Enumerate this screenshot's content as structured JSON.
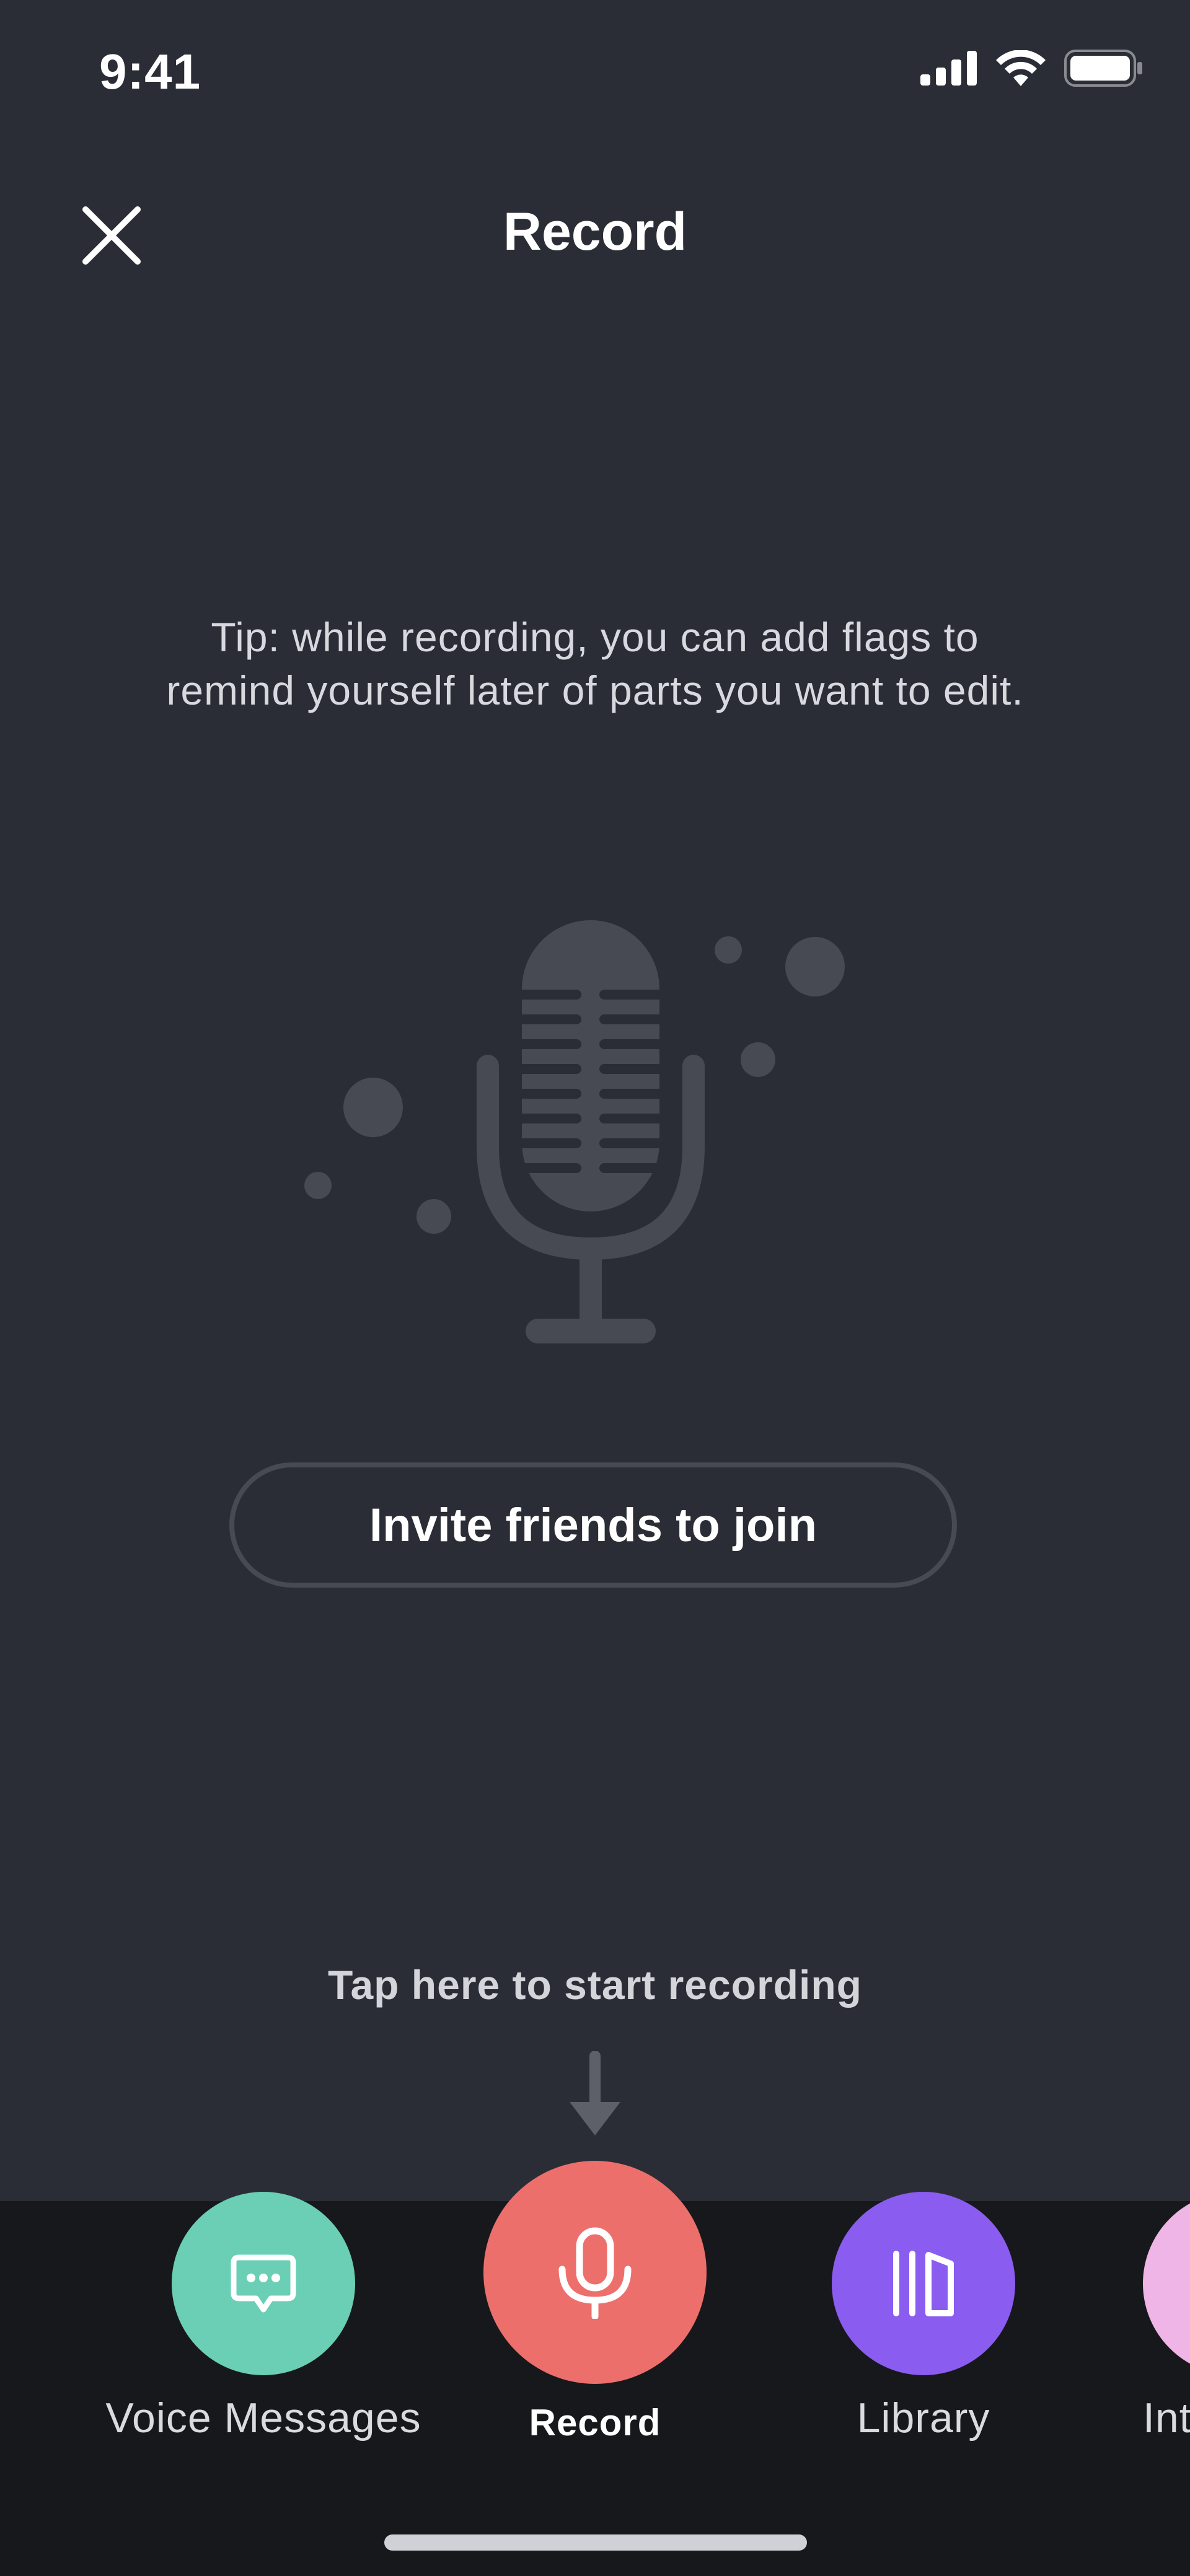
{
  "status_bar": {
    "time": "9:41",
    "icons": [
      "signal-icon",
      "wifi-icon",
      "battery-icon"
    ]
  },
  "header": {
    "title": "Record",
    "close_icon": "close-icon"
  },
  "tip": {
    "text": "Tip: while recording, you can add flags to remind yourself later of parts you want to edit."
  },
  "illustration": {
    "icon": "microphone-icon"
  },
  "invite": {
    "label": "Invite friends to join"
  },
  "hint": {
    "text": "Tap here to start recording",
    "icon": "arrow-down-icon"
  },
  "tab_bar": {
    "items": [
      {
        "label": "Voice Messages",
        "icon": "chat-bubble-icon",
        "color": "#6acfb4",
        "active": false
      },
      {
        "label": "Record",
        "icon": "microphone-icon",
        "color": "#ed6f6b",
        "active": true
      },
      {
        "label": "Library",
        "icon": "library-icon",
        "color": "#8b5cf0",
        "active": false
      },
      {
        "label": "Int",
        "icon": "interview-icon",
        "color": "#efb5e6",
        "active": false
      }
    ]
  },
  "colors": {
    "background": "#2a2d35",
    "tab_bar_background": "#17181c",
    "illustration": "#474a53",
    "outline": "#474a52"
  }
}
